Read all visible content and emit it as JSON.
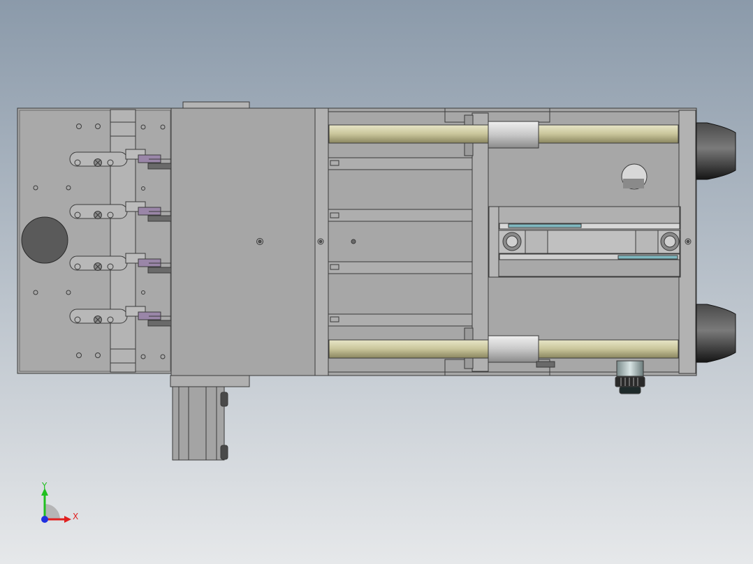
{
  "view": {
    "background_top": "#8b9aaa",
    "background_bottom": "#e6e8ea",
    "part_fill": "#a8a8a8",
    "part_stroke": "#3a3a3a",
    "rod_color": "#c9c59a",
    "clamp_accent": "#9a86a8",
    "slot_accent": "#7fb8c0",
    "nozzle_color": "#2a2a2a"
  },
  "triad": {
    "x_label": "X",
    "y_label": "Y",
    "x_color": "#e02020",
    "y_color": "#20c020",
    "z_color": "#2030e0"
  }
}
